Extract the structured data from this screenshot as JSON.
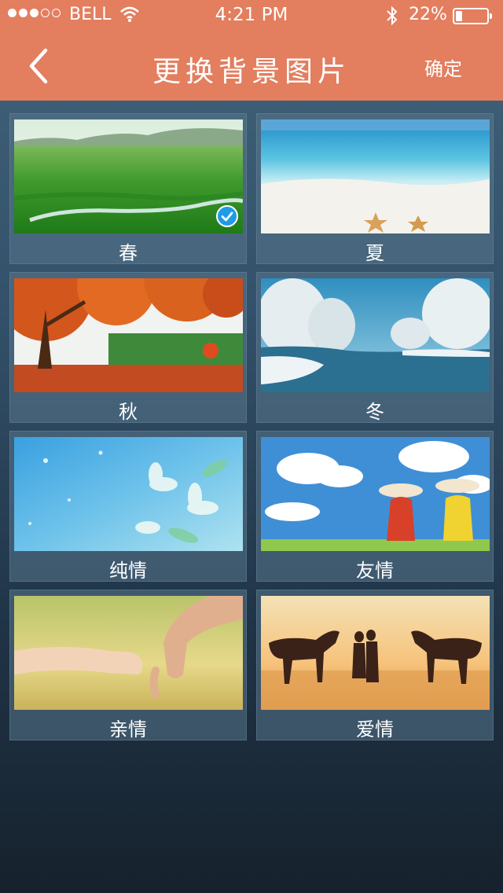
{
  "status_bar": {
    "carrier": "BELL",
    "time": "4:21 PM",
    "battery": "22%",
    "battery_level": 0.22
  },
  "header": {
    "title": "更换背景图片",
    "confirm_label": "确定"
  },
  "wallpapers": [
    {
      "label": "春",
      "selected": true
    },
    {
      "label": "夏",
      "selected": false
    },
    {
      "label": "秋",
      "selected": false
    },
    {
      "label": "冬",
      "selected": false
    },
    {
      "label": "纯情",
      "selected": false
    },
    {
      "label": "友情",
      "selected": false
    },
    {
      "label": "亲情",
      "selected": false
    },
    {
      "label": "爱情",
      "selected": false
    }
  ],
  "colors": {
    "header_bg": "#e37e5f",
    "selected_check": "#1f9be8"
  }
}
